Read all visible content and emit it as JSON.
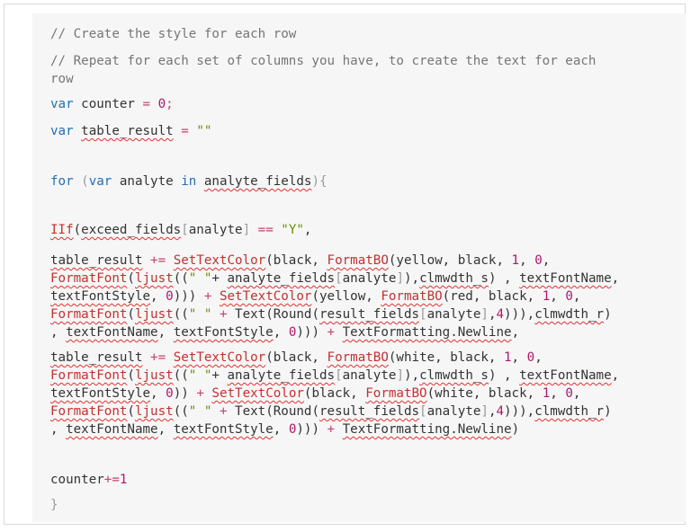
{
  "code_lines": [
    [
      {
        "t": "// Create the style for each row",
        "c": "cm"
      }
    ],
    [
      {
        "t": "// Repeat for each set of columns you have, to create the text for each",
        "c": "cm"
      }
    ],
    [
      {
        "t": "row",
        "c": "cm"
      }
    ],
    [
      {
        "t": "var",
        "c": "kw"
      },
      {
        "t": " counter "
      },
      {
        "t": "=",
        "c": "op"
      },
      {
        "t": " "
      },
      {
        "t": "0",
        "c": "num"
      },
      {
        "t": ";",
        "c": "op"
      }
    ],
    [
      {
        "t": "var",
        "c": "kw"
      },
      {
        "t": " "
      },
      {
        "t": "table_result",
        "s": 1
      },
      {
        "t": " "
      },
      {
        "t": "=",
        "c": "op"
      },
      {
        "t": " "
      },
      {
        "t": "\"\"",
        "c": "str"
      }
    ],
    [
      {
        "t": "for",
        "c": "kw"
      },
      {
        "t": " "
      },
      {
        "t": "(",
        "c": "pn"
      },
      {
        "t": "var",
        "c": "kw"
      },
      {
        "t": " analyte "
      },
      {
        "t": "in",
        "c": "kw"
      },
      {
        "t": " "
      },
      {
        "t": "analyte_fields",
        "s": 1
      },
      {
        "t": ")",
        "c": "pn"
      },
      {
        "t": "{",
        "c": "pn"
      }
    ],
    [
      {
        "t": "IIf",
        "c": "fn",
        "s": 1
      },
      {
        "t": "("
      },
      {
        "t": "exceed_fields",
        "s": 1
      },
      {
        "t": "[",
        "c": "pn"
      },
      {
        "t": "analyte"
      },
      {
        "t": "]",
        "c": "pn"
      },
      {
        "t": " "
      },
      {
        "t": "==",
        "c": "op"
      },
      {
        "t": " "
      },
      {
        "t": "\"Y\"",
        "c": "str"
      },
      {
        "t": ","
      }
    ],
    [
      {
        "t": "table_result",
        "s": 1
      },
      {
        "t": " "
      },
      {
        "t": "+=",
        "c": "op"
      },
      {
        "t": " "
      },
      {
        "t": "SetTextColor",
        "c": "fn",
        "s": 1
      },
      {
        "t": "(black, "
      },
      {
        "t": "FormatBO",
        "c": "fn",
        "s": 1
      },
      {
        "t": "(yellow, black, "
      },
      {
        "t": "1",
        "c": "num"
      },
      {
        "t": ", "
      },
      {
        "t": "0",
        "c": "num"
      },
      {
        "t": ","
      }
    ],
    [
      {
        "t": "FormatFont",
        "c": "fn",
        "s": 1
      },
      {
        "t": "("
      },
      {
        "t": "ljust",
        "c": "fn",
        "s": 1
      },
      {
        "t": "(("
      },
      {
        "t": "\" \"",
        "c": "str"
      },
      {
        "t": "+ "
      },
      {
        "t": "analyte_fields",
        "s": 1
      },
      {
        "t": "[",
        "c": "pn"
      },
      {
        "t": "analyte"
      },
      {
        "t": "]",
        "c": "pn"
      },
      {
        "t": "),"
      },
      {
        "t": "clmwdth_s",
        "s": 1
      },
      {
        "t": ") , "
      },
      {
        "t": "textFontName",
        "s": 1
      },
      {
        "t": ","
      }
    ],
    [
      {
        "t": "textFontStyle",
        "s": 1
      },
      {
        "t": ", "
      },
      {
        "t": "0",
        "c": "num"
      },
      {
        "t": "))) "
      },
      {
        "t": "+",
        "c": "op"
      },
      {
        "t": " "
      },
      {
        "t": "SetTextColor",
        "c": "fn",
        "s": 1
      },
      {
        "t": "(yellow, "
      },
      {
        "t": "FormatBO",
        "c": "fn",
        "s": 1
      },
      {
        "t": "(red, black, "
      },
      {
        "t": "1",
        "c": "num"
      },
      {
        "t": ", "
      },
      {
        "t": "0",
        "c": "num"
      },
      {
        "t": ","
      }
    ],
    [
      {
        "t": "FormatFont",
        "c": "fn",
        "s": 1
      },
      {
        "t": "("
      },
      {
        "t": "ljust",
        "c": "fn",
        "s": 1
      },
      {
        "t": "(("
      },
      {
        "t": "\" \"",
        "c": "str"
      },
      {
        "t": " "
      },
      {
        "t": "+",
        "c": "op"
      },
      {
        "t": " Text(Round("
      },
      {
        "t": "result_fields",
        "s": 1
      },
      {
        "t": "[",
        "c": "pn"
      },
      {
        "t": "analyte"
      },
      {
        "t": "]",
        "c": "pn"
      },
      {
        "t": ","
      },
      {
        "t": "4",
        "c": "num"
      },
      {
        "t": "))),"
      },
      {
        "t": "clmwdth_r",
        "s": 1
      },
      {
        "t": ")"
      }
    ],
    [
      {
        "t": ", "
      },
      {
        "t": "textFontName",
        "s": 1
      },
      {
        "t": ", "
      },
      {
        "t": "textFontStyle",
        "s": 1
      },
      {
        "t": ", "
      },
      {
        "t": "0",
        "c": "num"
      },
      {
        "t": "))) "
      },
      {
        "t": "+",
        "c": "op"
      },
      {
        "t": " "
      },
      {
        "t": "TextFormatting.Newline",
        "s": 1
      },
      {
        "t": ","
      }
    ],
    [
      {
        "t": "table_result",
        "s": 1
      },
      {
        "t": " "
      },
      {
        "t": "+=",
        "c": "op"
      },
      {
        "t": " "
      },
      {
        "t": "SetTextColor",
        "c": "fn",
        "s": 1
      },
      {
        "t": "(black, "
      },
      {
        "t": "FormatBO",
        "c": "fn",
        "s": 1
      },
      {
        "t": "(white, black, "
      },
      {
        "t": "1",
        "c": "num"
      },
      {
        "t": ", "
      },
      {
        "t": "0",
        "c": "num"
      },
      {
        "t": ","
      }
    ],
    [
      {
        "t": "FormatFont",
        "c": "fn",
        "s": 1
      },
      {
        "t": "("
      },
      {
        "t": "ljust",
        "c": "fn",
        "s": 1
      },
      {
        "t": "(("
      },
      {
        "t": "\" \"",
        "c": "str"
      },
      {
        "t": "+ "
      },
      {
        "t": "analyte_fields",
        "s": 1
      },
      {
        "t": "[",
        "c": "pn"
      },
      {
        "t": "analyte"
      },
      {
        "t": "]",
        "c": "pn"
      },
      {
        "t": "),"
      },
      {
        "t": "clmwdth_s",
        "s": 1
      },
      {
        "t": ") , "
      },
      {
        "t": "textFontName",
        "s": 1
      },
      {
        "t": ","
      }
    ],
    [
      {
        "t": "textFontStyle",
        "s": 1
      },
      {
        "t": ", "
      },
      {
        "t": "0",
        "c": "num"
      },
      {
        "t": ")) "
      },
      {
        "t": "+",
        "c": "op"
      },
      {
        "t": " "
      },
      {
        "t": "SetTextColor",
        "c": "fn",
        "s": 1
      },
      {
        "t": "(black, "
      },
      {
        "t": "FormatBO",
        "c": "fn",
        "s": 1
      },
      {
        "t": "(white, black, "
      },
      {
        "t": "1",
        "c": "num"
      },
      {
        "t": ", "
      },
      {
        "t": "0",
        "c": "num"
      },
      {
        "t": ","
      }
    ],
    [
      {
        "t": "FormatFont",
        "c": "fn",
        "s": 1
      },
      {
        "t": "("
      },
      {
        "t": "ljust",
        "c": "fn",
        "s": 1
      },
      {
        "t": "(("
      },
      {
        "t": "\" \"",
        "c": "str"
      },
      {
        "t": " "
      },
      {
        "t": "+",
        "c": "op"
      },
      {
        "t": " Text(Round("
      },
      {
        "t": "result_fields",
        "s": 1
      },
      {
        "t": "[",
        "c": "pn"
      },
      {
        "t": "analyte"
      },
      {
        "t": "]",
        "c": "pn"
      },
      {
        "t": ","
      },
      {
        "t": "4",
        "c": "num"
      },
      {
        "t": "))),"
      },
      {
        "t": "clmwdth_r",
        "s": 1
      },
      {
        "t": ")"
      }
    ],
    [
      {
        "t": ", "
      },
      {
        "t": "textFontName",
        "s": 1
      },
      {
        "t": ", "
      },
      {
        "t": "textFontStyle",
        "s": 1
      },
      {
        "t": ", "
      },
      {
        "t": "0",
        "c": "num"
      },
      {
        "t": "))) "
      },
      {
        "t": "+",
        "c": "op"
      },
      {
        "t": " "
      },
      {
        "t": "TextFormatting.Newline",
        "s": 1
      },
      {
        "t": ")"
      }
    ],
    [
      {
        "t": "counter"
      },
      {
        "t": "+=",
        "c": "op"
      },
      {
        "t": "1",
        "c": "num"
      }
    ],
    [
      {
        "t": "}",
        "c": "pn"
      }
    ]
  ],
  "colors": {
    "background": "#f6f6f6",
    "keyword": "#1f6fb4",
    "comment": "#767676",
    "number": "#b0166b",
    "string": "#6a8f00",
    "operator": "#c4446b",
    "function": "#c4302f",
    "squiggle": "#e23030"
  }
}
